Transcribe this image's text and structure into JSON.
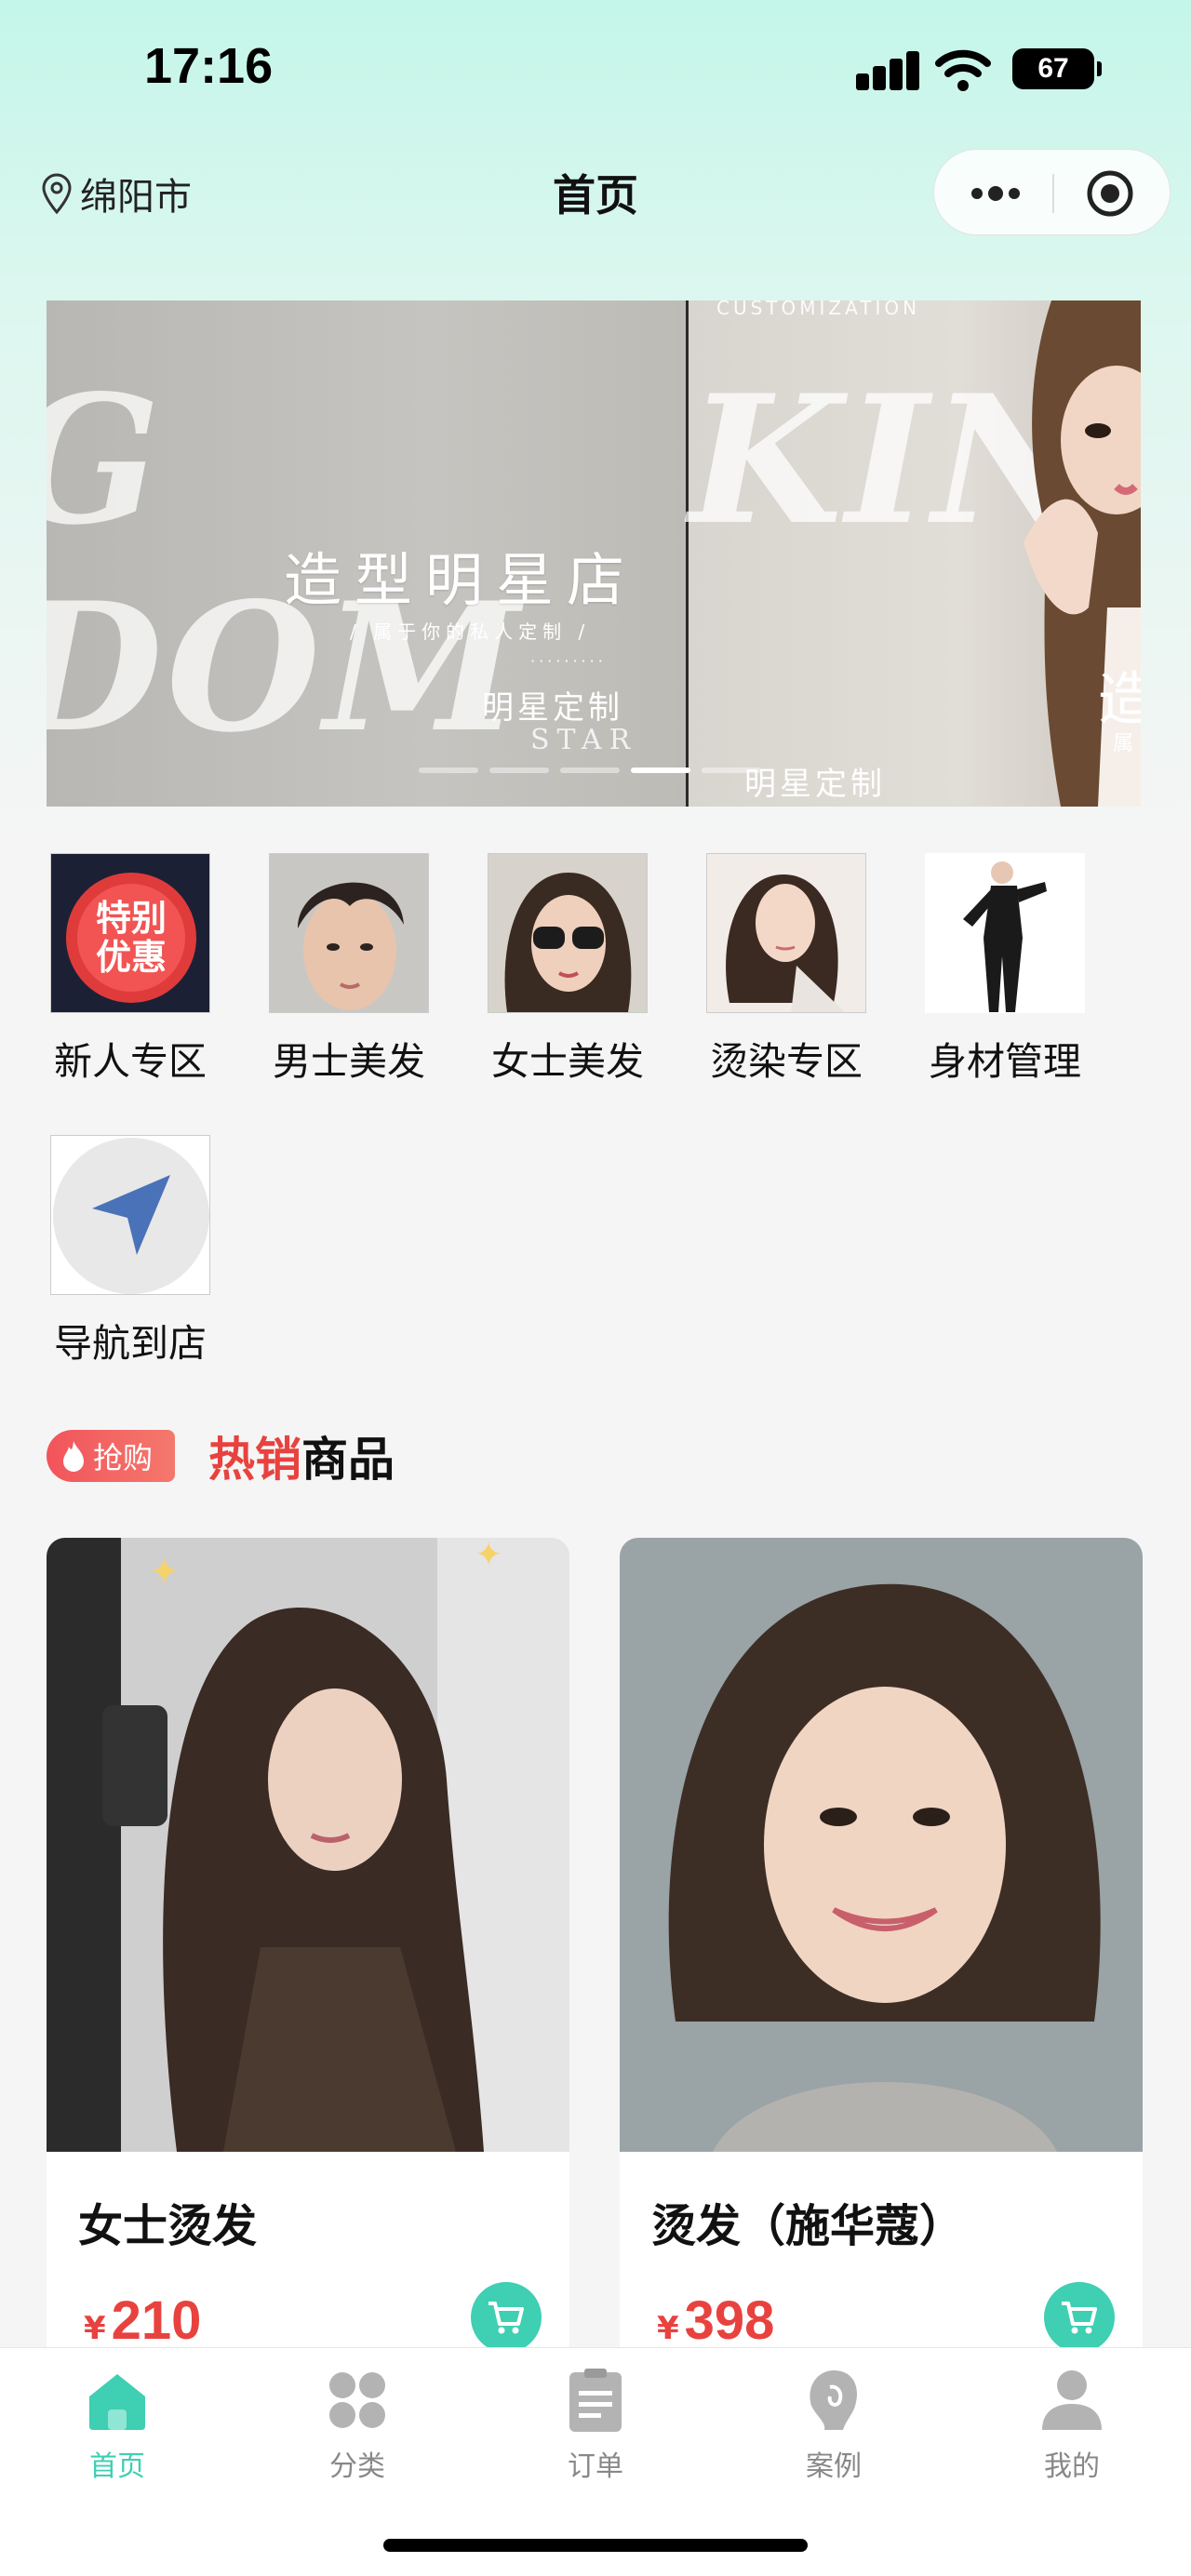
{
  "status_bar": {
    "time": "17:16",
    "battery": "67"
  },
  "nav": {
    "location": "绵阳市",
    "title": "首页"
  },
  "banner": {
    "big_word_left": "G DOM",
    "big_word_right": "KIN",
    "store_name": "造型明星店",
    "tagline": "/ 属于你的私人定制 /",
    "dots": "·········",
    "sub": "明星定制",
    "en": "STAR",
    "right_top": "CUSTOMIZATION",
    "right_sub": "明星定制",
    "right_cut": "造",
    "right_cut_small": "属",
    "slide_count": 5,
    "active_slide": 4
  },
  "categories": [
    {
      "label": "新人专区",
      "icon": "special-offer-image"
    },
    {
      "label": "男士美发",
      "icon": "men-hair-image"
    },
    {
      "label": "女士美发",
      "icon": "women-hair-image"
    },
    {
      "label": "烫染专区",
      "icon": "perm-dye-image"
    },
    {
      "label": "身材管理",
      "icon": "body-management-image"
    },
    {
      "label": "导航到店",
      "icon": "navigation-arrow-icon"
    }
  ],
  "special_badge_text": "特别优惠",
  "hot": {
    "badge": "抢购",
    "title_red": "热销",
    "title_black": "商品"
  },
  "products": [
    {
      "name": "女士烫发",
      "currency": "¥",
      "price": "210"
    },
    {
      "name": "烫发（施华蔻）",
      "currency": "¥",
      "price": "398"
    }
  ],
  "tabs": [
    {
      "label": "首页",
      "icon": "home-icon",
      "active": true
    },
    {
      "label": "分类",
      "icon": "grid-icon",
      "active": false
    },
    {
      "label": "订单",
      "icon": "clipboard-icon",
      "active": false
    },
    {
      "label": "案例",
      "icon": "case-icon",
      "active": false
    },
    {
      "label": "我的",
      "icon": "user-icon",
      "active": false
    }
  ],
  "colors": {
    "accent": "#3fcfb3",
    "hot_red": "#e8423f",
    "header_tint": "#c4f6e9"
  }
}
